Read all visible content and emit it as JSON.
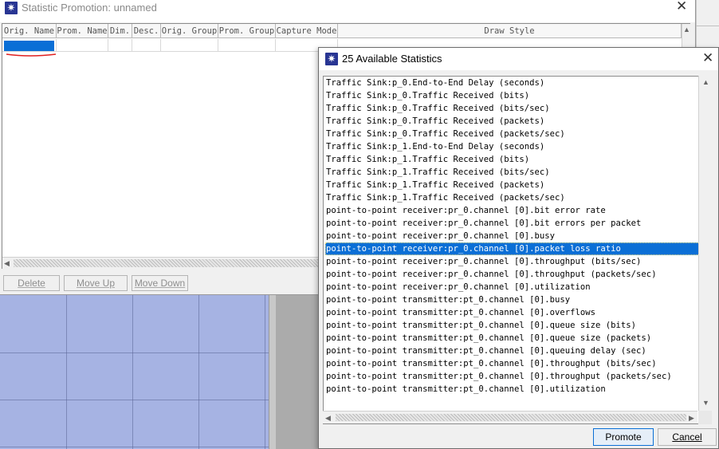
{
  "main_window": {
    "title": "Statistic Promotion: unnamed",
    "close_glyph": "✕",
    "app_icon_glyph": "✷",
    "table_headers": [
      "Orig. Name",
      "Prom. Name",
      "Dim.",
      "Desc.",
      "Orig. Group",
      "Prom. Group",
      "Capture Mode",
      "Draw Style"
    ],
    "buttons": {
      "delete": "Delete",
      "move_up": "Move Up",
      "move_down": "Move Down"
    }
  },
  "dialog": {
    "title": "25 Available Statistics",
    "close_glyph": "✕",
    "items": [
      "Traffic Sink:p_0.End-to-End Delay (seconds)",
      "Traffic Sink:p_0.Traffic Received (bits)",
      "Traffic Sink:p_0.Traffic Received (bits/sec)",
      "Traffic Sink:p_0.Traffic Received (packets)",
      "Traffic Sink:p_0.Traffic Received (packets/sec)",
      "Traffic Sink:p_1.End-to-End Delay (seconds)",
      "Traffic Sink:p_1.Traffic Received (bits)",
      "Traffic Sink:p_1.Traffic Received (bits/sec)",
      "Traffic Sink:p_1.Traffic Received (packets)",
      "Traffic Sink:p_1.Traffic Received (packets/sec)",
      "point-to-point receiver:pr_0.channel [0].bit error rate",
      "point-to-point receiver:pr_0.channel [0].bit errors per packet",
      "point-to-point receiver:pr_0.channel [0].busy",
      "point-to-point receiver:pr_0.channel [0].packet loss ratio",
      "point-to-point receiver:pr_0.channel [0].throughput (bits/sec)",
      "point-to-point receiver:pr_0.channel [0].throughput (packets/sec)",
      "point-to-point receiver:pr_0.channel [0].utilization",
      "point-to-point transmitter:pt_0.channel [0].busy",
      "point-to-point transmitter:pt_0.channel [0].overflows",
      "point-to-point transmitter:pt_0.channel [0].queue size (bits)",
      "point-to-point transmitter:pt_0.channel [0].queue size (packets)",
      "point-to-point transmitter:pt_0.channel [0].queuing delay (sec)",
      "point-to-point transmitter:pt_0.channel [0].throughput (bits/sec)",
      "point-to-point transmitter:pt_0.channel [0].throughput (packets/sec)",
      "point-to-point transmitter:pt_0.channel [0].utilization"
    ],
    "selected_index": 13,
    "buttons": {
      "promote": "Promote",
      "cancel": "Cancel"
    }
  },
  "icons": {
    "app": "app-star-icon",
    "close": "close-icon",
    "scroll_up": "arrow-up-icon",
    "scroll_down": "arrow-down-icon",
    "scroll_left": "arrow-left-icon",
    "scroll_right": "arrow-right-icon"
  },
  "colors": {
    "selection": "#0a6fd6",
    "app_icon_bg": "#283593",
    "annotation_red": "#e02020",
    "background_canvas": "#a6b3e3"
  }
}
